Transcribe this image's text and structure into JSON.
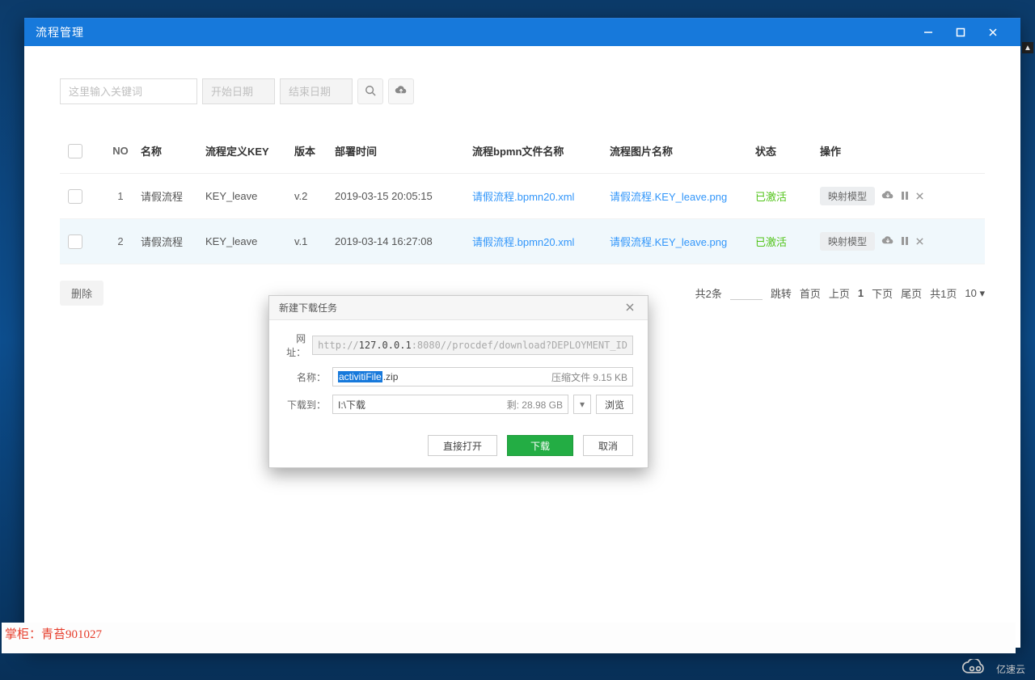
{
  "window": {
    "title": "流程管理"
  },
  "toolbar": {
    "keyword_placeholder": "这里输入关键词",
    "start_date_placeholder": "开始日期",
    "end_date_placeholder": "结束日期"
  },
  "table": {
    "headers": {
      "no": "NO",
      "name": "名称",
      "key": "流程定义KEY",
      "ver": "版本",
      "time": "部署时间",
      "bpmn": "流程bpmn文件名称",
      "img": "流程图片名称",
      "stat": "状态",
      "op": "操作"
    },
    "rows": [
      {
        "no": "1",
        "name": "请假流程",
        "key": "KEY_leave",
        "ver": "v.2",
        "time": "2019-03-15 20:05:15",
        "bpmn": "请假流程.bpmn20.xml",
        "img": "请假流程.KEY_leave.png",
        "stat": "已激活",
        "op_tag": "映射模型"
      },
      {
        "no": "2",
        "name": "请假流程",
        "key": "KEY_leave",
        "ver": "v.1",
        "time": "2019-03-14 16:27:08",
        "bpmn": "请假流程.bpmn20.xml",
        "img": "请假流程.KEY_leave.png",
        "stat": "已激活",
        "op_tag": "映射模型"
      }
    ]
  },
  "below": {
    "delete": "删除"
  },
  "pager": {
    "total": "共2条",
    "jump": "跳转",
    "first": "首页",
    "prev": "上页",
    "cur": "1",
    "next": "下页",
    "last": "尾页",
    "pages": "共1页",
    "size": "10 ▾"
  },
  "dialog": {
    "title": "新建下载任务",
    "labels": {
      "url": "网址：",
      "name": "名称：",
      "path": "下载到："
    },
    "url_gray1": "http://",
    "url_dark": "127.0.0.1",
    "url_gray2": ":8080//procdef/download?DEPLOYMENT_ID",
    "name_sel": "activitiFile",
    "name_ext": ".zip",
    "name_meta": "压缩文件 9.15 KB",
    "path": "I:\\下载",
    "path_free": "剩: 28.98 GB",
    "browse": "浏览",
    "open": "直接打开",
    "download": "下载",
    "cancel": "取消"
  },
  "sign": "掌柜：青苔901027",
  "watermark": "亿速云"
}
